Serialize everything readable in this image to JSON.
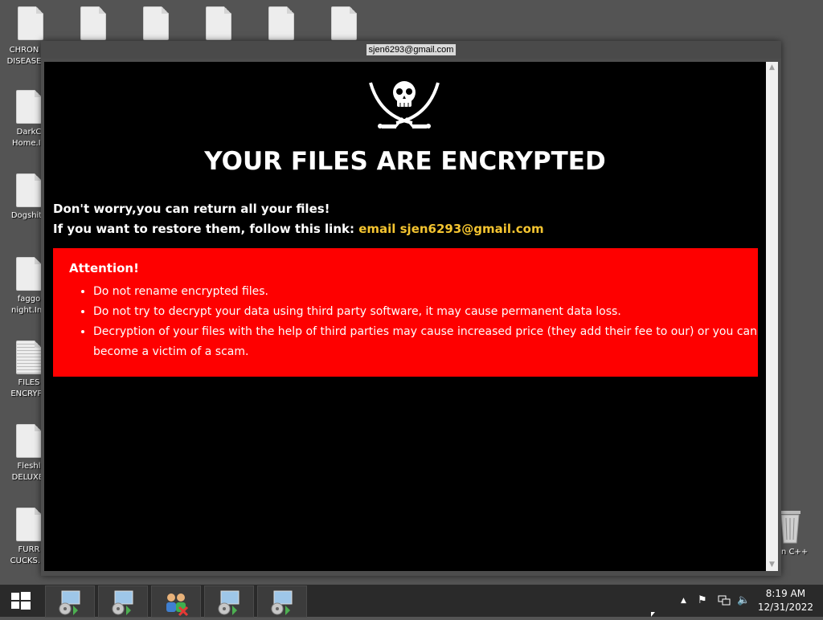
{
  "desktop": {
    "icons": [
      {
        "label": "CHRON\nDISEASE",
        "icon": "file-icon"
      },
      {
        "label": "DarkC\nHome.In",
        "icon": "file-icon"
      },
      {
        "label": "Dogshit.l",
        "icon": "file-icon"
      },
      {
        "label": "faggo\nnight.Ink",
        "icon": "file-icon"
      },
      {
        "label": "FILES\nENCRYPT",
        "icon": "text-file-icon"
      },
      {
        "label": "Fleshl\nDELUXE.",
        "icon": "file-icon"
      },
      {
        "label": "FURR\nCUCKS.In",
        "icon": "file-icon"
      }
    ],
    "top_row_count": 6,
    "recycle_bin_label": "n C++"
  },
  "window": {
    "title": "sjen6293@gmail.com",
    "headline": "YOUR FILES ARE ENCRYPTED",
    "line1": "Don't worry,you can return all your files!",
    "line2_prefix": "If you want to restore them, follow this link: ",
    "line2_link": "email sjen6293@gmail.com",
    "attention": {
      "title": "Attention!",
      "items": [
        "Do not rename encrypted files.",
        "Do not try to decrypt your data using third party software, it may cause permanent data loss.",
        "Decryption of your files with the help of third parties may cause increased price (they add their fee to our) or you can become a victim of a scam."
      ]
    },
    "colors": {
      "background": "#000000",
      "attention_bg": "#fe0000",
      "link": "#f4c430"
    }
  },
  "taskbar": {
    "buttons": [
      {
        "icon": "installer-icon"
      },
      {
        "icon": "installer-icon"
      },
      {
        "icon": "users-icon"
      },
      {
        "icon": "installer-icon"
      },
      {
        "icon": "installer-icon"
      }
    ],
    "time": "8:19 AM",
    "date": "12/31/2022"
  }
}
